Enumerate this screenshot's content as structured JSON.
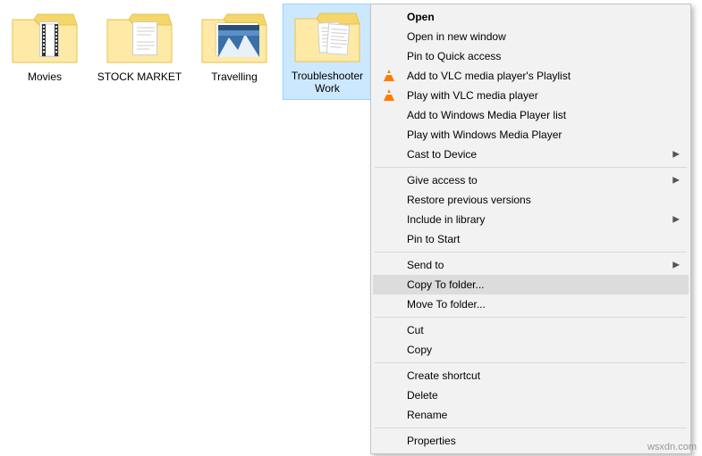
{
  "folders": [
    {
      "label": "Movies"
    },
    {
      "label": "STOCK MARKET"
    },
    {
      "label": "Travelling"
    },
    {
      "label": "Troubleshooter Work"
    }
  ],
  "menu": {
    "open": "Open",
    "open_new_window": "Open in new window",
    "pin_quick_access": "Pin to Quick access",
    "add_vlc_playlist": "Add to VLC media player's Playlist",
    "play_vlc": "Play with VLC media player",
    "add_wmp_list": "Add to Windows Media Player list",
    "play_wmp": "Play with Windows Media Player",
    "cast_to_device": "Cast to Device",
    "give_access_to": "Give access to",
    "restore_previous": "Restore previous versions",
    "include_in_library": "Include in library",
    "pin_to_start": "Pin to Start",
    "send_to": "Send to",
    "copy_to_folder": "Copy To folder...",
    "move_to_folder": "Move To folder...",
    "cut": "Cut",
    "copy": "Copy",
    "create_shortcut": "Create shortcut",
    "delete": "Delete",
    "rename": "Rename",
    "properties": "Properties"
  },
  "watermark": "wsxdn.com"
}
